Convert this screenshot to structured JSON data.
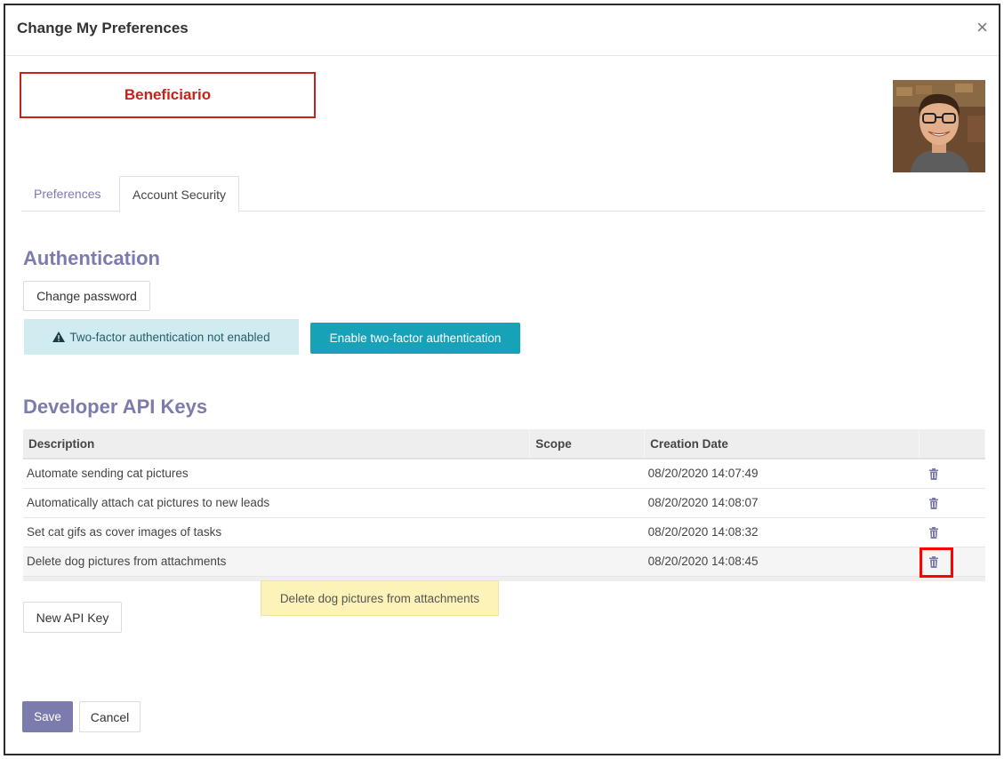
{
  "dialog": {
    "title": "Change My Preferences",
    "close_glyph": "×"
  },
  "user": {
    "name": "Beneficiario"
  },
  "tabs": [
    {
      "label": "Preferences"
    },
    {
      "label": "Account Security"
    }
  ],
  "authentication": {
    "heading": "Authentication",
    "change_password_label": "Change password",
    "alert_text": "Two-factor authentication not enabled",
    "enable_2fa_label": "Enable two-factor authentication"
  },
  "api_keys": {
    "heading": "Developer API Keys",
    "columns": [
      "Description",
      "Scope",
      "Creation Date",
      ""
    ],
    "rows": [
      {
        "description": "Automate sending cat pictures",
        "scope": "",
        "created": "08/20/2020 14:07:49"
      },
      {
        "description": "Automatically attach cat pictures to new leads",
        "scope": "",
        "created": "08/20/2020 14:08:07"
      },
      {
        "description": "Set cat gifs as cover images of tasks",
        "scope": "",
        "created": "08/20/2020 14:08:32"
      },
      {
        "description": "Delete dog pictures from attachments",
        "scope": "",
        "created": "08/20/2020 14:08:45"
      }
    ],
    "tooltip": "Delete dog pictures from attachments",
    "new_key_label": "New API Key"
  },
  "footer": {
    "save_label": "Save",
    "cancel_label": "Cancel"
  },
  "colors": {
    "accent": "#7c7bad",
    "teal": "#17a2b8",
    "alert_bg": "#d1ecf1",
    "highlight": "#ff0000",
    "name_red": "#c8211b"
  },
  "icons": {
    "trash": "trash-icon",
    "warning": "warning-icon",
    "close": "close-icon"
  }
}
